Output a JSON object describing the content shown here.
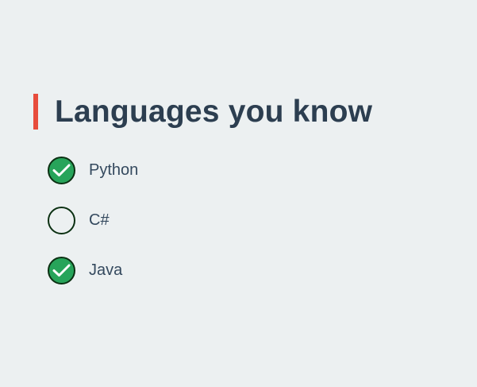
{
  "section": {
    "title": "Languages you know"
  },
  "options": [
    {
      "label": "Python",
      "checked": true
    },
    {
      "label": "C#",
      "checked": false
    },
    {
      "label": "Java",
      "checked": true
    }
  ],
  "colors": {
    "accent": "#e74c3c",
    "checked_fill": "#27a45a",
    "circle_border": "#0b3012",
    "heading": "#2c3e50",
    "label": "#34495e",
    "background": "#ecf0f1"
  },
  "icons": {
    "checked": "check-icon"
  }
}
